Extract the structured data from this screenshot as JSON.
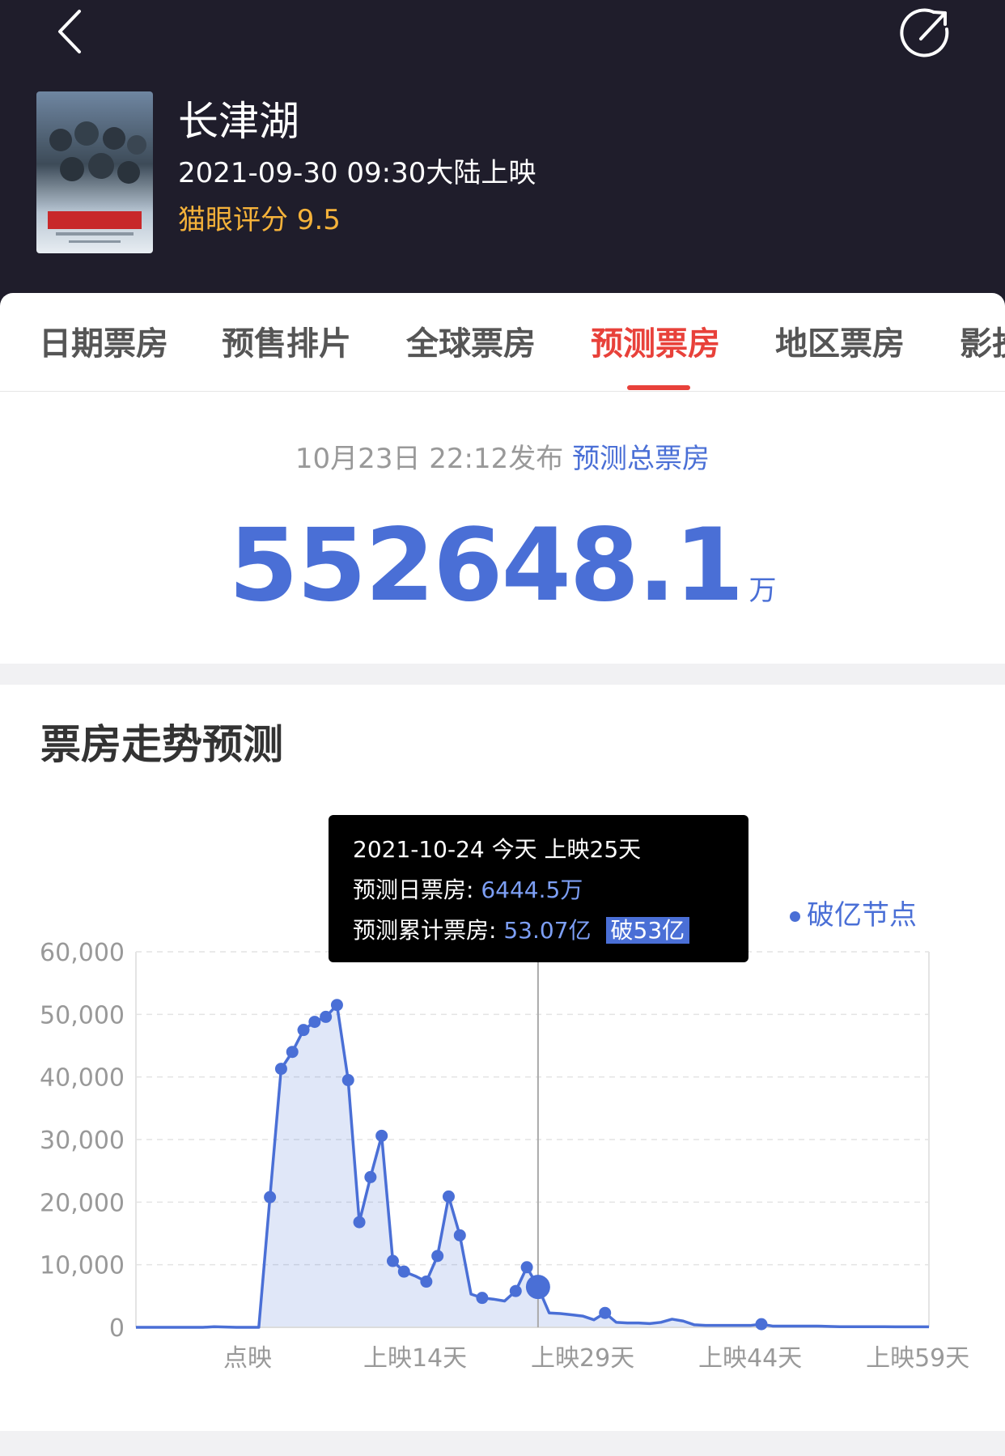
{
  "header": {
    "back_icon": "chevron-left-icon",
    "share_icon": "share-icon",
    "poster_name": "movie-poster",
    "title": "长津湖",
    "release": "2021-09-30 09:30大陆上映",
    "rating": "猫眼评分 9.5"
  },
  "tabs": [
    {
      "label": "日期票房"
    },
    {
      "label": "预售排片"
    },
    {
      "label": "全球票房"
    },
    {
      "label": "预测票房"
    },
    {
      "label": "地区票房"
    },
    {
      "label": "影投"
    }
  ],
  "summary": {
    "published": "10月23日 22:12发布",
    "link": "预测总票房",
    "total": "552648.1",
    "unit": "万"
  },
  "trend": {
    "title": "票房走势预测",
    "legend": "破亿节点"
  },
  "tooltip": {
    "date": "2021-10-24 今天 上映25天",
    "daily_label": "预测日票房: ",
    "daily_value": "6444.5万",
    "cum_label": "预测累计票房: ",
    "cum_value": "53.07亿",
    "badge": "破53亿"
  },
  "colors": {
    "header_bg": "#1f1d2b",
    "accent_red": "#e8413a",
    "accent_blue": "#4a6fd6",
    "rating_gold": "#f5b23a"
  },
  "chart_data": {
    "type": "area",
    "title": "票房走势预测",
    "xlabel": "",
    "ylabel": "",
    "ylim": [
      0,
      60000
    ],
    "yticks": [
      "60,000",
      "50,000",
      "40,000",
      "30,000",
      "20,000",
      "10,000",
      "0"
    ],
    "x_tick_labels": [
      {
        "day": 10,
        "label": "点映"
      },
      {
        "day": 25,
        "label": "上映14天"
      },
      {
        "day": 40,
        "label": "上映29天"
      },
      {
        "day": 55,
        "label": "上映44天"
      },
      {
        "day": 70,
        "label": "上映59天"
      }
    ],
    "x_range": [
      0,
      71
    ],
    "grid": true,
    "legend_position": "top-right",
    "current_day": 36,
    "series": [
      {
        "name": "破亿节点",
        "points": [
          [
            0,
            0
          ],
          [
            3,
            0
          ],
          [
            6,
            0
          ],
          [
            7,
            100
          ],
          [
            9,
            0
          ],
          [
            11,
            0
          ],
          [
            12,
            20800
          ],
          [
            13,
            41300
          ],
          [
            14,
            44000
          ],
          [
            15,
            47500
          ],
          [
            16,
            48800
          ],
          [
            17,
            49600
          ],
          [
            18,
            51500
          ],
          [
            19,
            39500
          ],
          [
            20,
            16800
          ],
          [
            21,
            24000
          ],
          [
            22,
            30600
          ],
          [
            23,
            10600
          ],
          [
            24,
            8900
          ],
          [
            25,
            8200
          ],
          [
            26,
            7300
          ],
          [
            27,
            11400
          ],
          [
            28,
            20900
          ],
          [
            29,
            14700
          ],
          [
            30,
            5300
          ],
          [
            31,
            4700
          ],
          [
            32,
            4500
          ],
          [
            33,
            4200
          ],
          [
            34,
            5800
          ],
          [
            35,
            9600
          ],
          [
            36,
            6444.5
          ],
          [
            37,
            2300
          ],
          [
            38,
            2200
          ],
          [
            39,
            2000
          ],
          [
            40,
            1800
          ],
          [
            41,
            1200
          ],
          [
            42,
            2300
          ],
          [
            43,
            800
          ],
          [
            44,
            700
          ],
          [
            45,
            700
          ],
          [
            46,
            600
          ],
          [
            47,
            800
          ],
          [
            48,
            1300
          ],
          [
            49,
            1000
          ],
          [
            50,
            400
          ],
          [
            51,
            300
          ],
          [
            52,
            300
          ],
          [
            53,
            300
          ],
          [
            54,
            300
          ],
          [
            55,
            300
          ],
          [
            56,
            500
          ],
          [
            57,
            200
          ],
          [
            58,
            200
          ],
          [
            59,
            200
          ],
          [
            60,
            200
          ],
          [
            61,
            200
          ],
          [
            62,
            150
          ],
          [
            63,
            100
          ],
          [
            64,
            100
          ],
          [
            65,
            100
          ],
          [
            66,
            100
          ],
          [
            67,
            100
          ],
          [
            68,
            80
          ],
          [
            69,
            80
          ],
          [
            70,
            80
          ],
          [
            71,
            80
          ]
        ],
        "markers": [
          12,
          13,
          14,
          15,
          16,
          17,
          18,
          19,
          20,
          21,
          22,
          23,
          24,
          26,
          27,
          28,
          29,
          31,
          34,
          35,
          36,
          42,
          56
        ]
      }
    ]
  }
}
